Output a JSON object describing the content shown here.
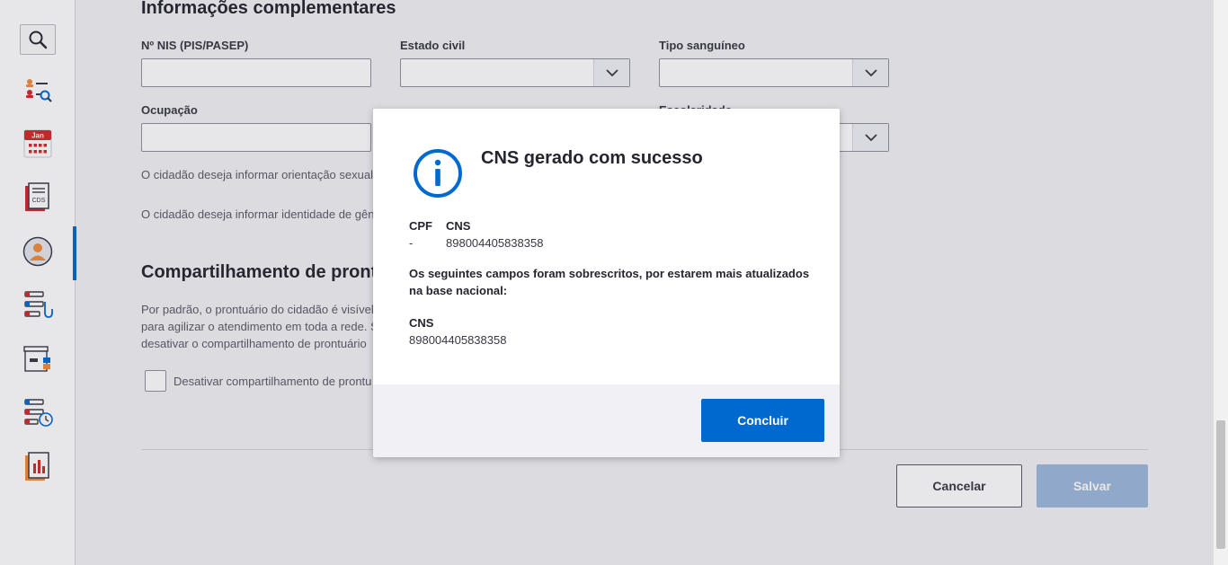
{
  "sidebar": {
    "items": [
      {
        "name": "search-icon"
      },
      {
        "name": "citizen-search-icon"
      },
      {
        "name": "calendar-icon",
        "label": "Jan"
      },
      {
        "name": "cds-document-icon",
        "label": "CDS"
      },
      {
        "name": "citizen-avatar-icon"
      },
      {
        "name": "clinical-list-icon"
      },
      {
        "name": "archive-icon"
      },
      {
        "name": "schedule-list-icon"
      },
      {
        "name": "report-chart-icon"
      }
    ]
  },
  "form": {
    "section_info_title": "Informações complementares",
    "nis_label": "Nº NIS (PIS/PASEP)",
    "estado_civil_label": "Estado civil",
    "tipo_sanguineo_label": "Tipo sanguíneo",
    "ocupacao_label": "Ocupação",
    "escolaridade_label": "Escolaridade",
    "orientacao_text": "O cidadão deseja informar orientação sexual",
    "identidade_text": "O cidadão deseja informar identidade de gên",
    "section_share_title": "Compartilhamento de pront",
    "share_text_1": "Por padrão, o prontuário do cidadão é visível",
    "share_text_2": "para agilizar o atendimento em toda a rede. S",
    "share_text_3": "desativar o compartilhamento de prontuário",
    "share_checkbox_label": "Desativar compartilhamento de prontu",
    "cancel_label": "Cancelar",
    "save_label": "Salvar"
  },
  "modal": {
    "title": "CNS gerado com sucesso",
    "cpf_label": "CPF",
    "cpf_value": "-",
    "cns_label": "CNS",
    "cns_value": "898004405838358",
    "overwrite_text": "Os seguintes campos foram sobrescritos, por estarem mais atualizados na base nacional:",
    "field_label": "CNS",
    "field_value": "898004405838358",
    "confirm_label": "Concluir"
  },
  "colors": {
    "primary": "#0069d0",
    "primary_disabled": "#9cb9dc",
    "accent_orange": "#f28b3b",
    "accent_red": "#d12a2a"
  }
}
